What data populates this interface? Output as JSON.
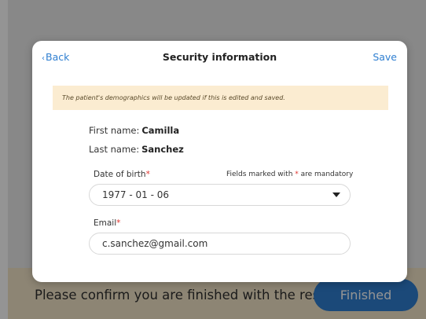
{
  "background": {
    "confirm_text": "Please confirm you are finished with the results",
    "finished_label": "Finished"
  },
  "modal": {
    "back_label": "Back",
    "title": "Security information",
    "save_label": "Save",
    "notice": "The patient's demographics will be updated if this is edited and saved.",
    "first_name_label": "First name:",
    "first_name": "Camilla",
    "last_name_label": "Last name:",
    "last_name": "Sanchez",
    "dob_label": "Date of birth",
    "required_marker": "*",
    "mandatory_prefix": "Fields marked with ",
    "mandatory_suffix": " are mandatory",
    "dob_value": "1977 - 01 - 06",
    "email_label": "Email",
    "email_value": "c.sanchez@gmail.com"
  },
  "colors": {
    "accent": "#2f7fd1",
    "required": "#e0322c",
    "notice_bg": "#fbecd1"
  },
  "icons": {
    "back": "chevron-left-icon",
    "dropdown": "caret-down-icon"
  }
}
